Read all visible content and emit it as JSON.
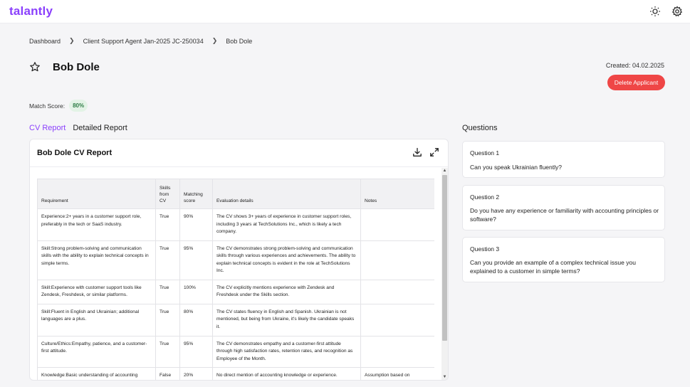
{
  "app": {
    "logo": "talantly"
  },
  "breadcrumb": [
    "Dashboard",
    "Client Support Agent Jan-2025 JC-250034",
    "Bob Dole"
  ],
  "applicant": {
    "name": "Bob Dole",
    "match_label": "Match Score:",
    "match_value": "80%",
    "created": "Created: 04.02.2025",
    "delete_label": "Delete Applicant"
  },
  "tabs": {
    "cv_report": "CV Report",
    "detailed_report": "Detailed Report"
  },
  "report": {
    "title": "Bob Dole CV Report",
    "columns": [
      "Requirement",
      "Skills from CV",
      "Matching score",
      "Evaluation details",
      "Notes"
    ],
    "rows": [
      {
        "requirement": "Experience:2+ years in a customer support role, preferably in the tech or SaaS industry.",
        "skills": "True",
        "score": "90%",
        "details": "The CV shows 3+ years of experience in customer support roles, including 3 years at TechSolutions Inc., which is likely a tech company.",
        "notes": ""
      },
      {
        "requirement": "Skill:Strong problem-solving and communication skills with the ability to explain technical concepts in simple terms.",
        "skills": "True",
        "score": "95%",
        "details": "The CV demonstrates strong problem-solving and communication skills through various experiences and achievements. The ability to explain technical concepts is evident in the role at TechSolutions Inc.",
        "notes": ""
      },
      {
        "requirement": "Skill:Experience with customer support tools like Zendesk, Freshdesk, or similar platforms.",
        "skills": "True",
        "score": "100%",
        "details": "The CV explicitly mentions experience with Zendesk and Freshdesk under the Skills section.",
        "notes": ""
      },
      {
        "requirement": "Skill:Fluent in English and Ukrainian; additional languages are a plus.",
        "skills": "True",
        "score": "80%",
        "details": "The CV states fluency in English and Spanish. Ukrainian is not mentioned, but being from Ukraine, it's likely the candidate speaks it.",
        "notes": ""
      },
      {
        "requirement": "Culture/Ethics:Empathy, patience, and a customer-first attitude.",
        "skills": "True",
        "score": "95%",
        "details": "The CV demonstrates empathy and a customer-first attitude through high satisfaction rates, retention rates, and recognition as Employee of the Month.",
        "notes": ""
      },
      {
        "requirement": "Knowledge:Basic understanding of accounting principles or prior experience with accounting",
        "skills": "False",
        "score": "20%",
        "details": "No direct mention of accounting knowledge or experience. However, the candidate's experience with CRM management",
        "notes": "Assumption based on transferable skills from CRM"
      }
    ]
  },
  "questions": {
    "title": "Questions",
    "items": [
      {
        "label": "Question 1",
        "text": "Can you speak Ukrainian fluently?"
      },
      {
        "label": "Question 2",
        "text": "Do you have any experience or familiarity with accounting principles or software?"
      },
      {
        "label": "Question 3",
        "text": "Can you provide an example of a complex technical issue you explained to a customer in simple terms?"
      }
    ]
  },
  "icons": {
    "theme": "sun-icon",
    "settings": "gear-icon",
    "favorite": "star-icon",
    "download": "download-icon",
    "expand": "expand-icon"
  },
  "colors": {
    "brand": "#8a3ffc",
    "danger": "#ef4646",
    "match_badge_bg": "#e3f3e6",
    "match_badge_text": "#2e7d46"
  }
}
